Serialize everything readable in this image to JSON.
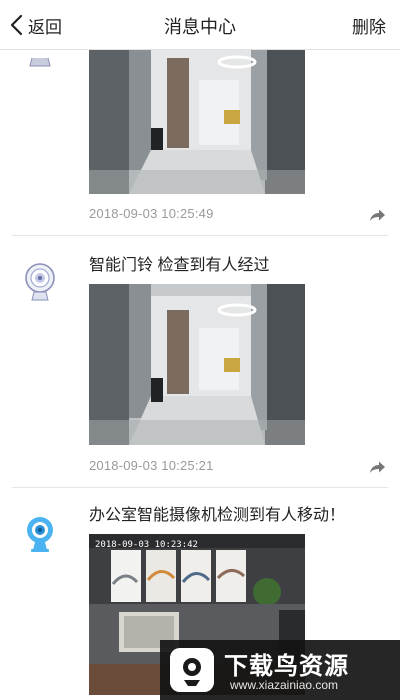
{
  "header": {
    "back_label": "返回",
    "title": "消息中心",
    "delete_label": "删除"
  },
  "messages": [
    {
      "title": "",
      "time": "2018-09-03 10:25:49",
      "device": "doorbell-camera-icon"
    },
    {
      "title": "智能门铃 检查到有人经过",
      "time": "2018-09-03 10:25:21",
      "device": "doorbell-camera-icon"
    },
    {
      "title": "办公室智能摄像机检测到有人移动！",
      "time": "",
      "device": "office-camera-icon",
      "overlay_time": "2018-09-03 10:23:42"
    }
  ],
  "watermark": {
    "brand": "下载鸟资源",
    "url": "www.xiazainiao.com"
  },
  "colors": {
    "text": "#222222",
    "time": "#9a9a9a",
    "divider": "#e6e6e6",
    "office_camera": "#4bb3f2"
  }
}
